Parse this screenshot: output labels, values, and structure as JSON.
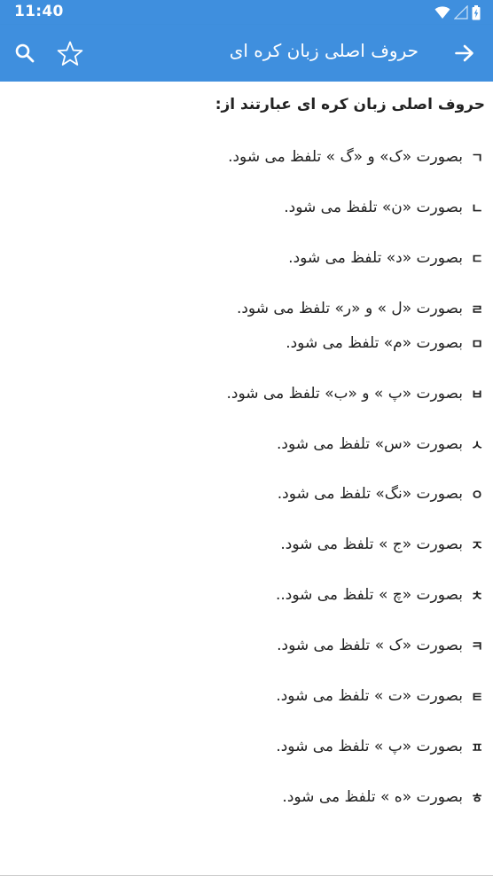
{
  "status_bar": {
    "time": "11:40",
    "icons": [
      "wifi-icon",
      "signal-icon",
      "battery-icon"
    ]
  },
  "app_bar": {
    "title": "حروف اصلی زبان کره ای",
    "icons": [
      "forward-arrow-icon",
      "star-outline-icon",
      "search-icon"
    ],
    "color": "#3f8fde"
  },
  "content": {
    "intro": "حروف اصلی زبان کره ای عبارتند از:",
    "letters": [
      {
        "letter": "ㄱ",
        "text": "بصورت «ک» و «گ » تلفظ می شود."
      },
      {
        "letter": "ㄴ",
        "text": "بصورت «ن» تلفظ می شود."
      },
      {
        "letter": "ㄷ",
        "text": "بصورت «د» تلفظ می شود."
      },
      {
        "letter": "ㄹ",
        "text": "بصورت «ل » و «ر» تلفظ می شود."
      },
      {
        "letter": "ㅁ",
        "text": "بصورت «م» تلفظ می شود."
      },
      {
        "letter": "ㅂ",
        "text": "بصورت «پ » و «ب» تلفظ می شود."
      },
      {
        "letter": "ㅅ",
        "text": "بصورت «س» تلفظ می شود."
      },
      {
        "letter": "ㅇ",
        "text": "بصورت «نگ» تلفظ می شود."
      },
      {
        "letter": "ㅈ",
        "text": "بصورت «ج » تلفظ می شود."
      },
      {
        "letter": "ㅊ",
        "text": "بصورت «چ » تلفظ می شود.."
      },
      {
        "letter": "ㅋ",
        "text": "بصورت «ک » تلفظ می شود."
      },
      {
        "letter": "ㅌ",
        "text": "بصورت «ت » تلفظ می شود."
      },
      {
        "letter": "ㅍ",
        "text": "بصورت «پ » تلفظ می شود."
      },
      {
        "letter": "ㅎ",
        "text": "بصورت «ه » تلفظ می شود."
      }
    ]
  }
}
